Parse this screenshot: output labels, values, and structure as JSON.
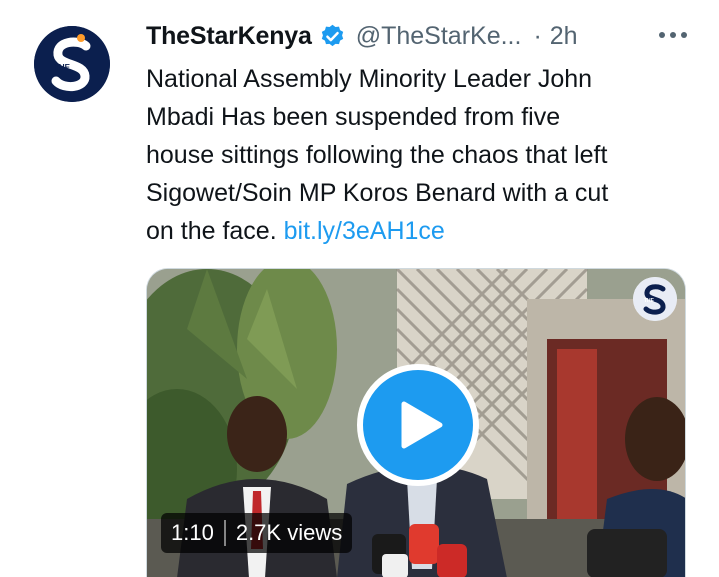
{
  "tweet": {
    "author": {
      "display_name": "TheStarKenya",
      "handle": "@TheStarKe...",
      "separator": "·",
      "time": "2h",
      "avatar_text": "S",
      "avatar_tag": "THE"
    },
    "text_lines": [
      "National Assembly Minority Leader John",
      "Mbadi Has been suspended from five",
      "house sittings following the chaos that left",
      "Sigowet/Soin MP Koros Benard with a cut"
    ],
    "text_last_prefix": "on the face.",
    "link": "bit.ly/3eAH1ce",
    "media": {
      "duration": "1:10",
      "views": "2.7K views",
      "logo_text": "S",
      "logo_tag": "THE"
    }
  },
  "colors": {
    "accent": "#1d9bf0",
    "secondary_text": "#536471",
    "brand_navy": "#0b1f4e"
  },
  "icons": {
    "verified": "verified-badge-icon",
    "more": "more-horizontal-icon",
    "play": "play-icon"
  }
}
